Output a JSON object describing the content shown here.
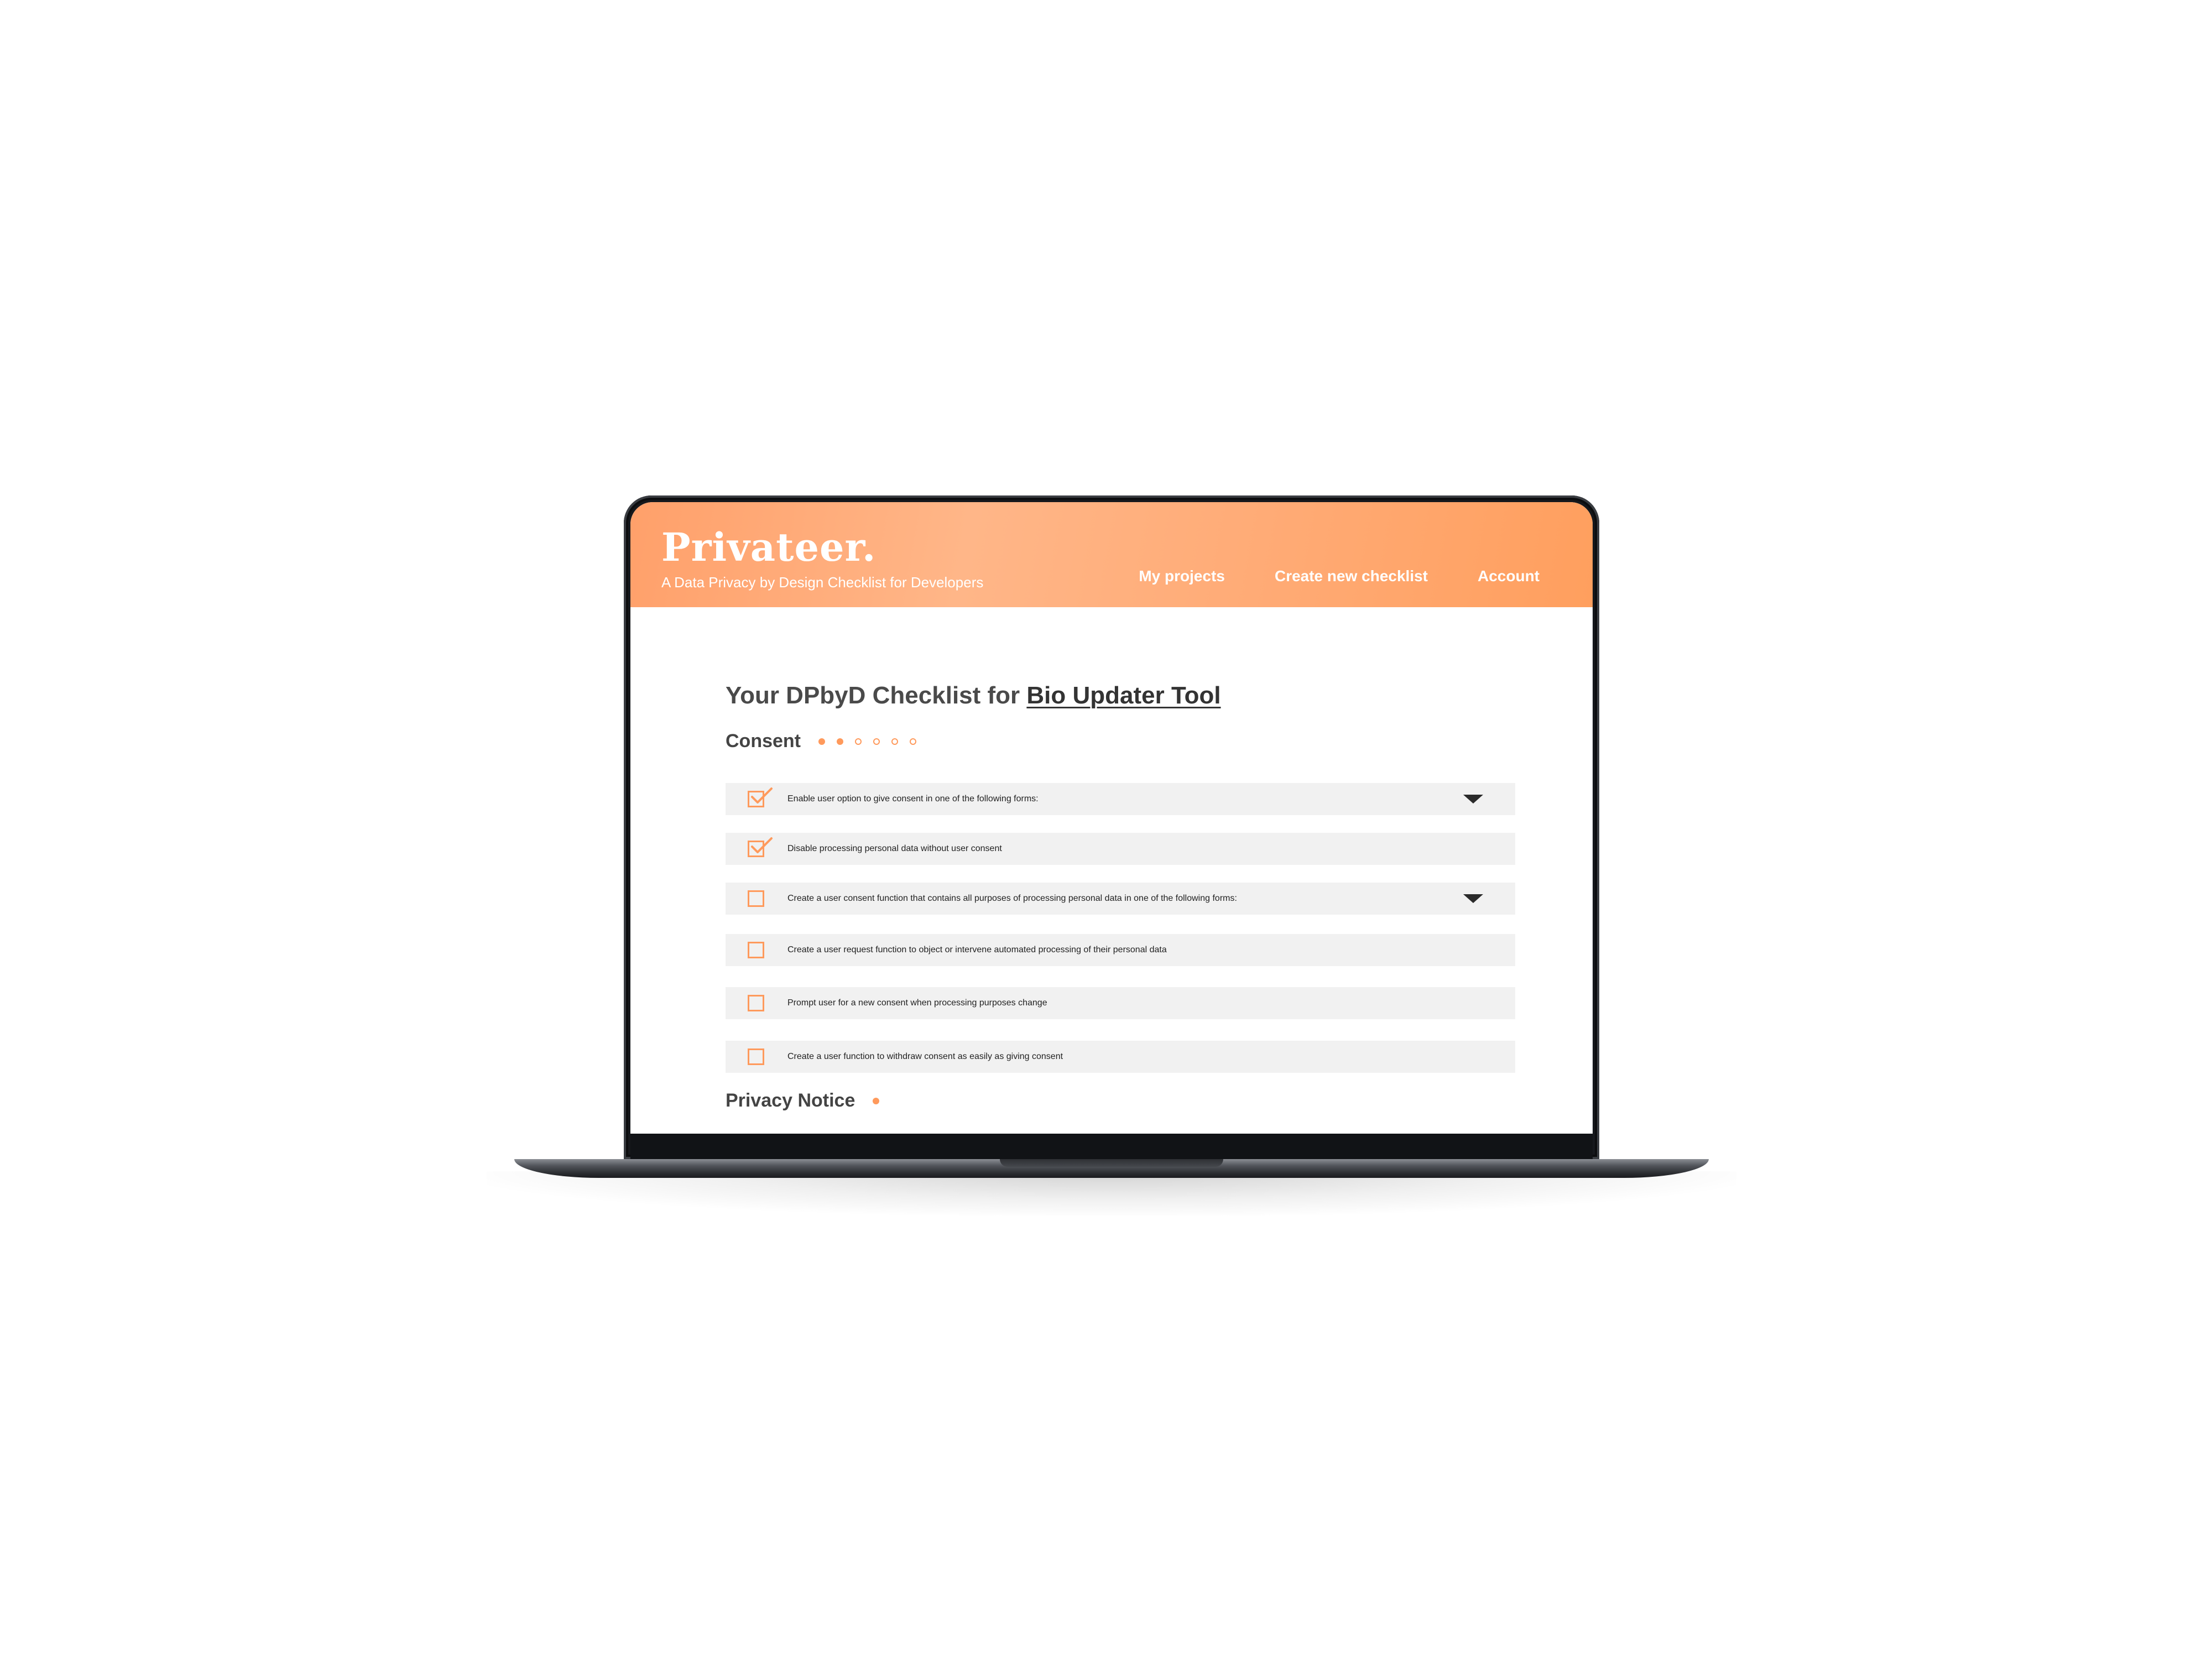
{
  "brand": {
    "logo": "Privateer.",
    "tagline": "A Data Privacy by Design Checklist for Developers"
  },
  "nav": {
    "items": [
      "My projects",
      "Create new checklist",
      "Account"
    ]
  },
  "page": {
    "title_prefix": "Your DPbyD Checklist for ",
    "project_name": "Bio Updater Tool"
  },
  "sections": [
    {
      "title": "Consent",
      "progress": [
        true,
        true,
        false,
        false,
        false,
        false
      ],
      "items": [
        {
          "label": "Enable user option to give consent in one of the following forms:",
          "checked": true,
          "expandable": true
        },
        {
          "label": "Disable processing personal data without user consent",
          "checked": true,
          "expandable": false
        },
        {
          "label": "Create a user consent function that contains all purposes of processing personal data in one of the following forms:",
          "checked": false,
          "expandable": true
        },
        {
          "label": "Create a user request function to object or intervene automated processing of their personal data",
          "checked": false,
          "expandable": false
        },
        {
          "label": "Prompt user for a new consent when processing purposes change",
          "checked": false,
          "expandable": false
        },
        {
          "label": "Create a user function to withdraw consent as easily as giving consent",
          "checked": false,
          "expandable": false
        }
      ]
    },
    {
      "title": "Privacy Notice",
      "progress": [
        true
      ]
    }
  ],
  "colors": {
    "accent": "#ff9a5c",
    "header_gradient_start": "#ffa06a",
    "header_gradient_end": "#ff9f5e",
    "row_background": "#f1f1f1",
    "title_text": "#4a4a4a"
  },
  "icons": {
    "checkbox_checked": "checkmark-icon",
    "expand": "caret-down-icon"
  }
}
